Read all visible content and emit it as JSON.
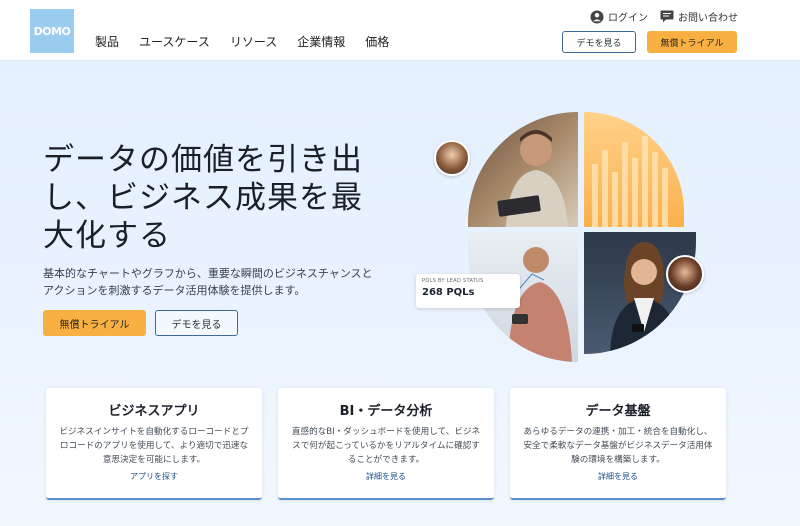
{
  "header": {
    "logo_text": "DOMO",
    "nav": [
      "製品",
      "ユースケース",
      "リソース",
      "企業情報",
      "価格"
    ],
    "login_label": "ログイン",
    "contact_label": "お問い合わせ",
    "demo_label": "デモを見る",
    "trial_label": "無償トライアル"
  },
  "hero": {
    "title": "データの価値を引き出し、ビジネス成果を最大化する",
    "subtitle": "基本的なチャートやグラフから、重要な瞬間のビジネスチャンスとアクションを刺激するデータ活用体験を提供します。",
    "trial_label": "無償トライアル",
    "demo_label": "デモを見る"
  },
  "stat": {
    "label": "PQLS BY LEAD STATUS",
    "value": "268 PQLs"
  },
  "cards": [
    {
      "title": "ビジネスアプリ",
      "desc": "ビジネスインサイトを自動化するローコードとプロコードのアプリを使用して、より適切で迅速な意思決定を可能にします。",
      "link": "アプリを探す"
    },
    {
      "title": "BI・データ分析",
      "desc": "直感的なBI・ダッシュボードを使用して、ビジネスで何が起こっているかをリアルタイムに確認することができます。",
      "link": "詳細を見る"
    },
    {
      "title": "データ基盤",
      "desc": "あらゆるデータの連携・加工・統合を自動化し、安全で柔軟なデータ基盤がビジネスデータ活用体験の環境を構築します。",
      "link": "詳細を見る"
    }
  ],
  "colors": {
    "accent_orange": "#f9b042",
    "brand_blue": "#99ccee",
    "outline_blue": "#3e6a9a"
  },
  "icons": {
    "login": "user-circle-icon",
    "contact": "chat-bubble-icon"
  }
}
